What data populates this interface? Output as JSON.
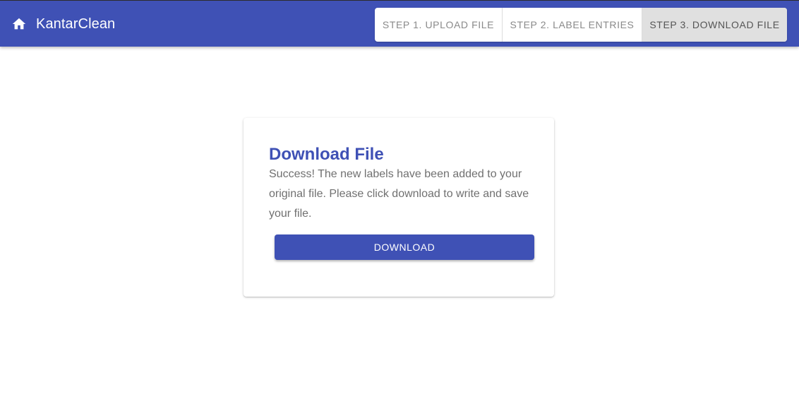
{
  "header": {
    "brand": "KantarClean",
    "home_icon": "home-icon",
    "background_color": "#3f51b5"
  },
  "steps": [
    {
      "label": "STEP 1. UPLOAD FILE",
      "active": false
    },
    {
      "label": "STEP 2. LABEL ENTRIES",
      "active": false
    },
    {
      "label": "STEP 3. DOWNLOAD FILE",
      "active": true
    }
  ],
  "card": {
    "title": "Download File",
    "message": "Success! The new labels have been added to your original file. Please click download to write and save your file.",
    "button_label": "DOWNLOAD"
  },
  "colors": {
    "primary": "#3f51b5",
    "step_active_bg": "#e0e0e0",
    "text_muted": "#707070"
  }
}
